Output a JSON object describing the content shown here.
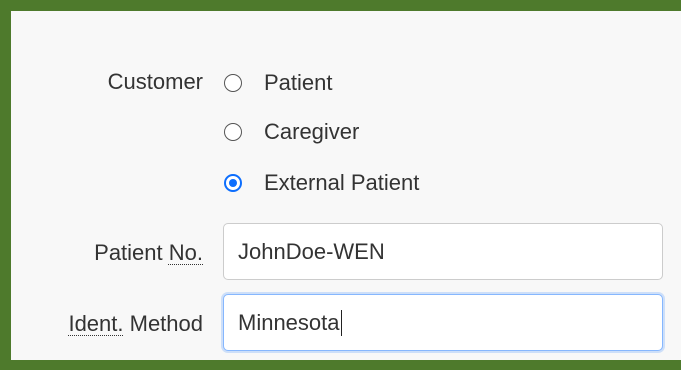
{
  "customer": {
    "label": "Customer",
    "options": [
      {
        "label": "Patient",
        "checked": false
      },
      {
        "label": "Caregiver",
        "checked": false
      },
      {
        "label": "External Patient",
        "checked": true
      }
    ]
  },
  "patient_no": {
    "label_main": "Patient ",
    "label_abbr": "No.",
    "value": "JohnDoe-WEN"
  },
  "ident_method": {
    "label_abbr": "Ident.",
    "label_main": " Method",
    "value": "Minnesota"
  },
  "colors": {
    "frame_border": "#4e7a2c",
    "accent": "#0d6efd",
    "panel_background": "#f8f8f8"
  }
}
